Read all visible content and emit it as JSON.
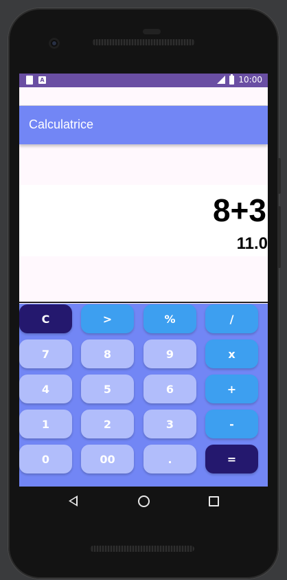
{
  "status_bar": {
    "time": "10:00",
    "notification_icons": [
      "sd-card-icon",
      "a-icon"
    ],
    "a_icon_text": "A",
    "system_icons": [
      "signal-icon",
      "battery-icon"
    ]
  },
  "app_bar": {
    "title": "Calculatrice"
  },
  "display": {
    "expression": "8+3",
    "result": "11.0"
  },
  "keypad": {
    "rows": [
      [
        {
          "label": "C",
          "style": "dark"
        },
        {
          "label": ">",
          "style": "blue"
        },
        {
          "label": "%",
          "style": "blue"
        },
        {
          "label": "/",
          "style": "blue"
        }
      ],
      [
        {
          "label": "7",
          "style": "light"
        },
        {
          "label": "8",
          "style": "light"
        },
        {
          "label": "9",
          "style": "light"
        },
        {
          "label": "x",
          "style": "blue"
        }
      ],
      [
        {
          "label": "4",
          "style": "light"
        },
        {
          "label": "5",
          "style": "light"
        },
        {
          "label": "6",
          "style": "light"
        },
        {
          "label": "+",
          "style": "blue"
        }
      ],
      [
        {
          "label": "1",
          "style": "light"
        },
        {
          "label": "2",
          "style": "light"
        },
        {
          "label": "3",
          "style": "light"
        },
        {
          "label": "-",
          "style": "blue"
        }
      ],
      [
        {
          "label": "0",
          "style": "light"
        },
        {
          "label": "00",
          "style": "light"
        },
        {
          "label": ".",
          "style": "light"
        },
        {
          "label": "=",
          "style": "dark"
        }
      ]
    ]
  },
  "colors": {
    "status_bar": "#6a4fa3",
    "app_bar": "#7286f5",
    "key_light": "#b1bdfb",
    "key_blue": "#3d9ff0",
    "key_dark": "#24186e",
    "screen_bg": "#fff8fd"
  },
  "navigation": {
    "buttons": [
      "back-icon",
      "home-icon",
      "recents-icon"
    ]
  }
}
